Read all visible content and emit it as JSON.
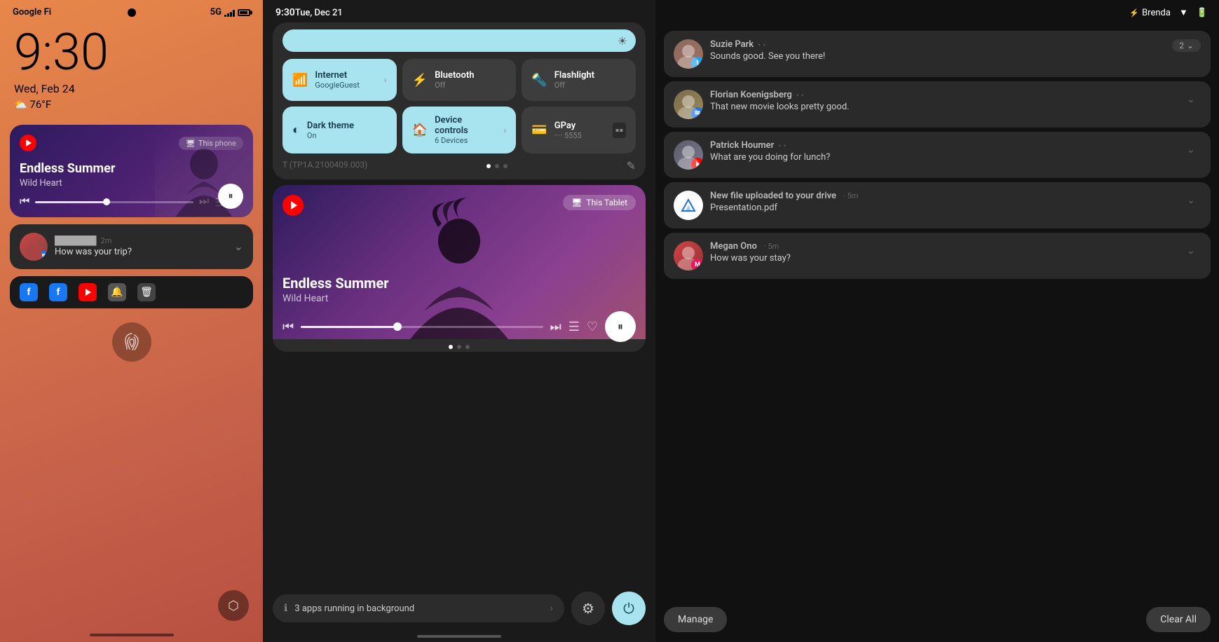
{
  "phone": {
    "carrier": "Google Fi",
    "network": "5G",
    "time": "9:30",
    "date": "Wed, Feb 24",
    "weather": "76°F",
    "music": {
      "app": "YouTube Music",
      "title": "Endless Summer",
      "subtitle": "Wild Heart",
      "device_badge": "This phone"
    },
    "notification": {
      "time": "2m",
      "message": "How was your trip?"
    },
    "apps": [
      "Facebook",
      "Facebook",
      "YouTube",
      "Bell",
      "Trash"
    ]
  },
  "tablet": {
    "time": "9:30",
    "date": "Tue, Dec 21",
    "quick_settings": {
      "brightness_label": "Brightness",
      "tiles": [
        {
          "title": "Internet",
          "sub": "GoogleGuest",
          "active": true,
          "icon": "wifi"
        },
        {
          "title": "Bluetooth",
          "sub": "Off",
          "active": false,
          "icon": "bluetooth"
        },
        {
          "title": "Flashlight",
          "sub": "Off",
          "active": false,
          "icon": "flashlight"
        },
        {
          "title": "Dark theme",
          "sub": "On",
          "active": true,
          "icon": "dark"
        },
        {
          "title": "Device controls",
          "sub": "6 Devices",
          "active": true,
          "icon": "device",
          "chevron": true
        },
        {
          "title": "GPay",
          "sub": "···· 5555",
          "active": false,
          "icon": "gpay"
        }
      ]
    },
    "build": "T (TP1A.2100409.003)",
    "music": {
      "title": "Endless Summer",
      "subtitle": "Wild Heart",
      "device_badge": "This Tablet"
    },
    "bottom": {
      "bg_apps": "3 apps running in background"
    }
  },
  "notifications": {
    "user": "Brenda",
    "items": [
      {
        "name": "Suzie Park",
        "app_badge": "Twitter",
        "count": "2",
        "message": "Sounds good. See you there!"
      },
      {
        "name": "Florian Koenigsberg",
        "app_badge": "Messages",
        "message": "That new movie looks pretty good."
      },
      {
        "name": "Patrick Houmer",
        "app_badge": "YouTube",
        "message": "What are you doing for lunch?"
      },
      {
        "type": "drive",
        "title": "New file uploaded to your drive",
        "time": "5m",
        "subtitle": "Presentation.pdf"
      },
      {
        "name": "Megan Ono",
        "time": "5m",
        "app_badge": "Messages",
        "message": "How was your stay?"
      }
    ],
    "manage_label": "Manage",
    "clear_all_label": "Clear All"
  }
}
